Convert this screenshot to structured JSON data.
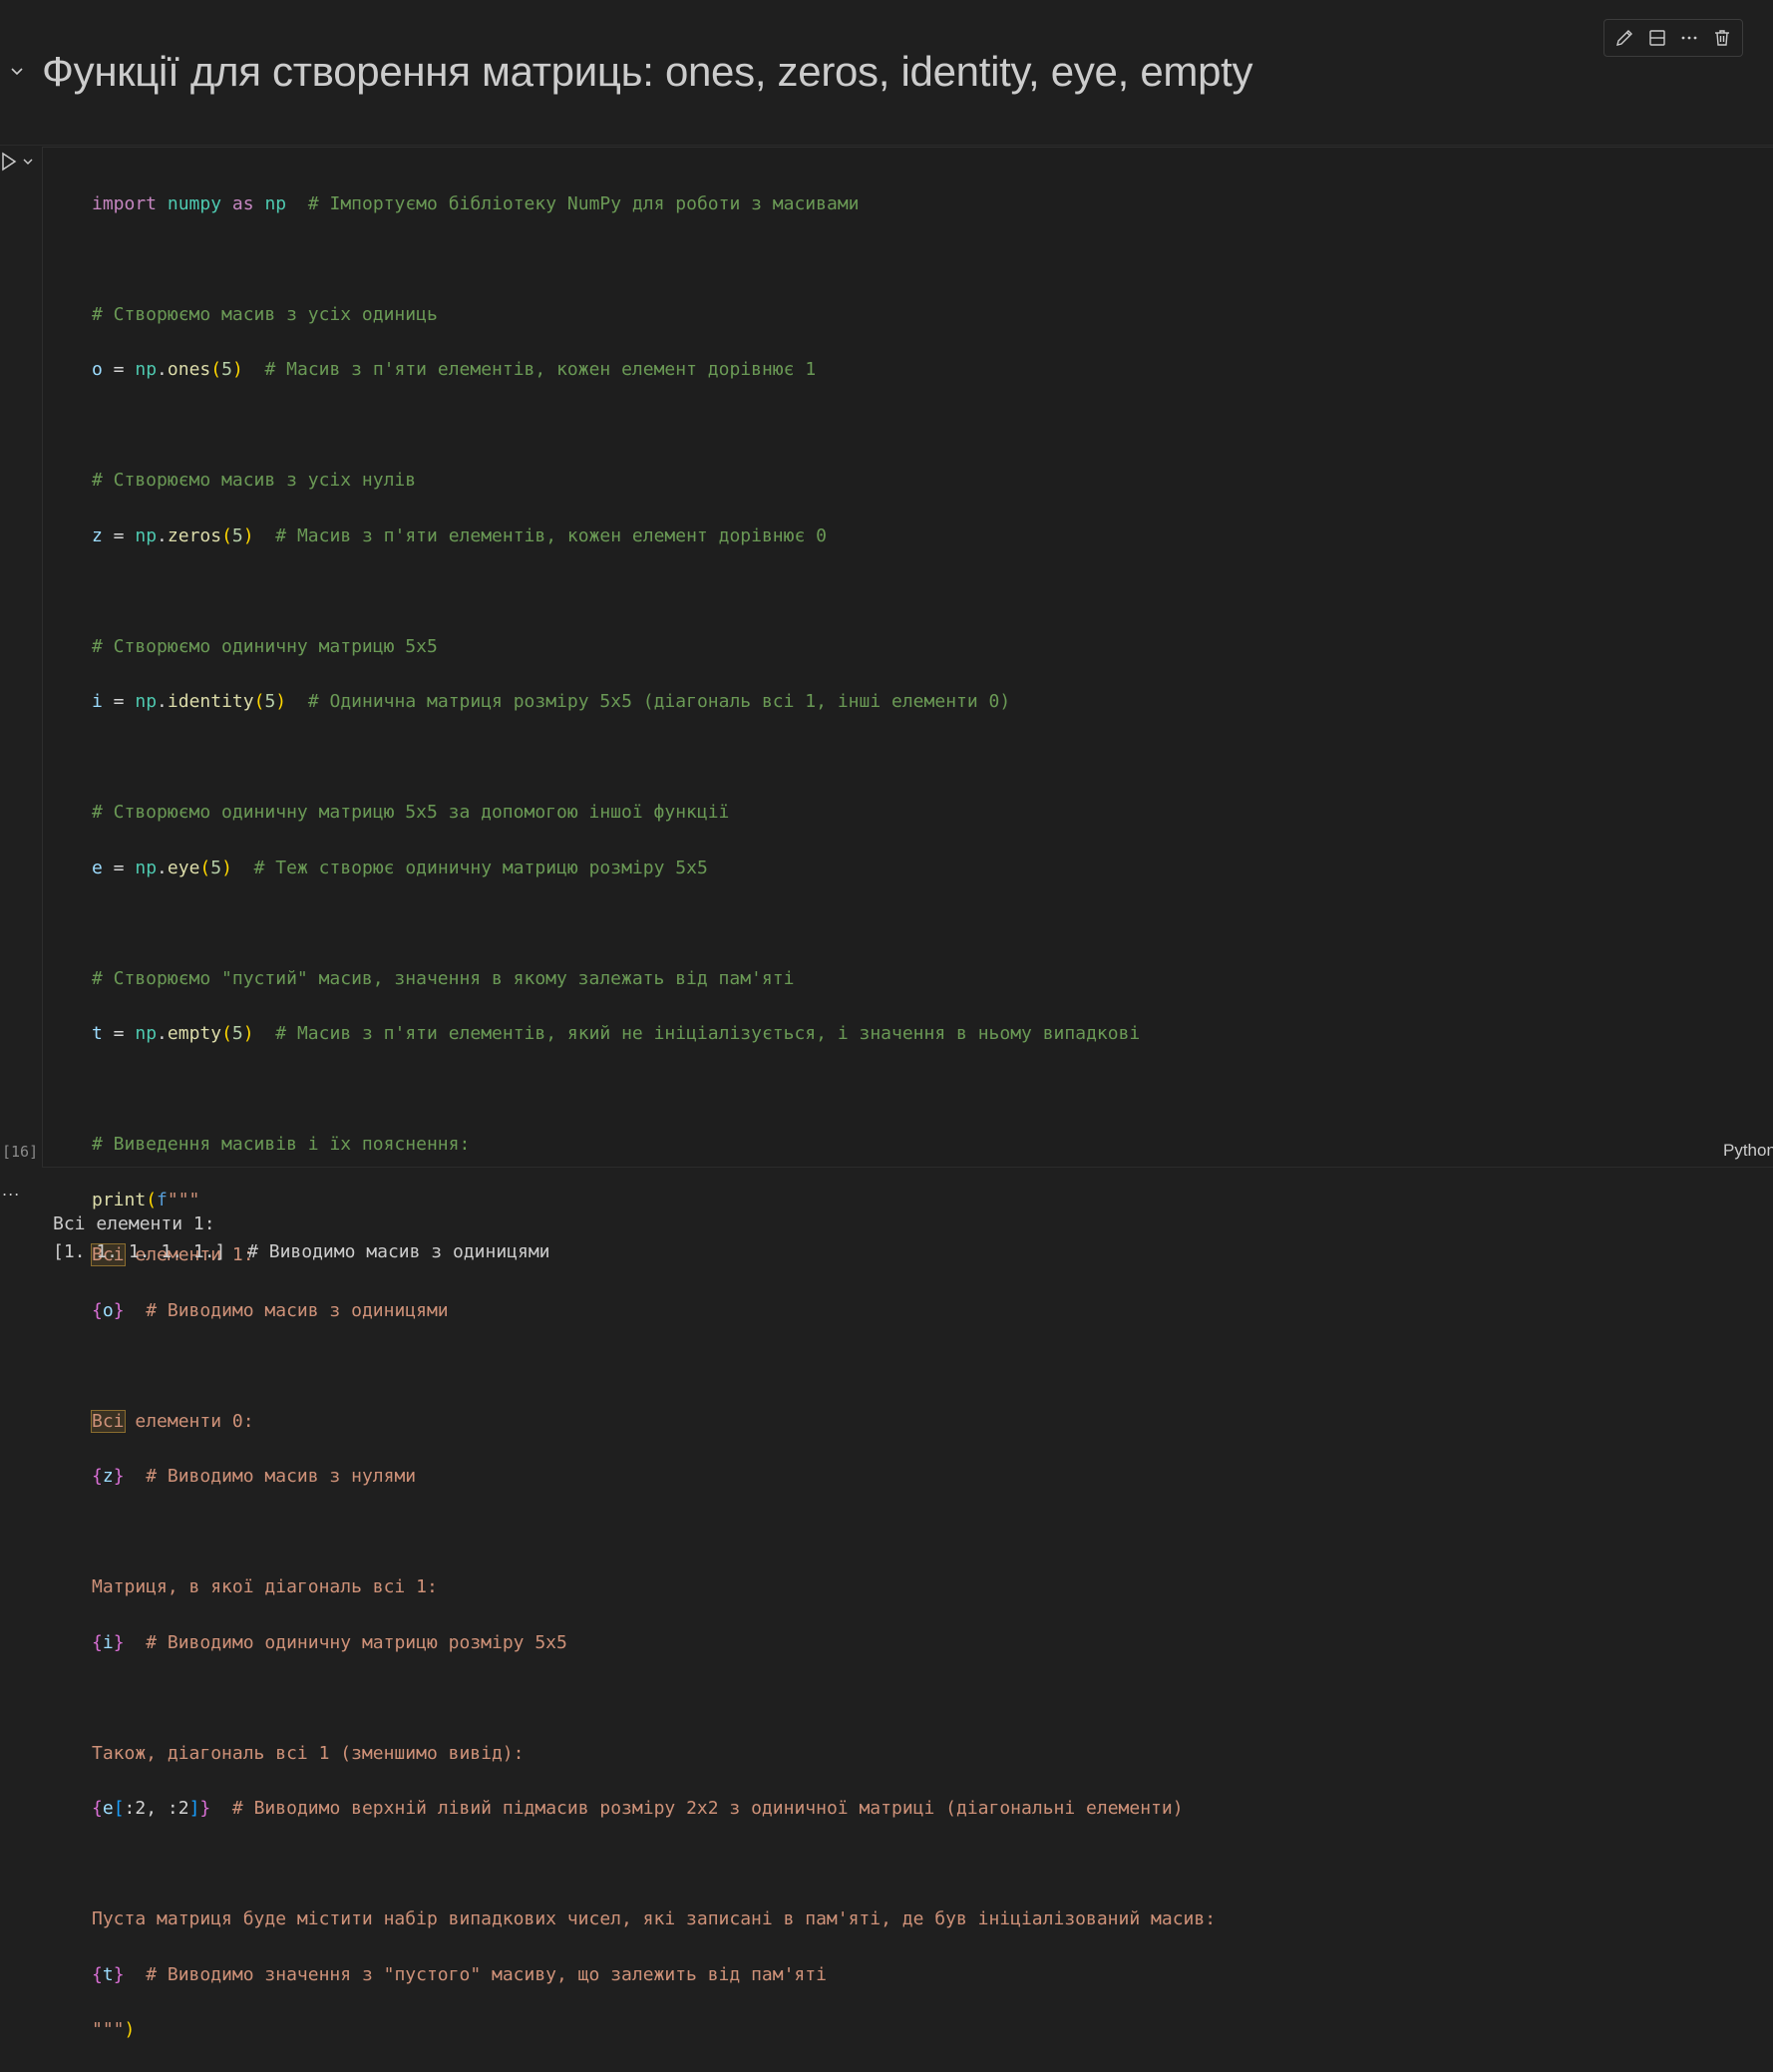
{
  "toolbar": {
    "icons": [
      "pencil-icon",
      "split-cell-icon",
      "more-icon",
      "trash-icon"
    ]
  },
  "markdown": {
    "heading": "Функції для створення матриць: ones, zeros, identity, eye, empty"
  },
  "cell": {
    "execution_count": "[16]",
    "language": "Python",
    "code": {
      "l1_kw": "import",
      "l1_mod": "numpy",
      "l1_as": "as",
      "l1_alias": "np",
      "l1_cm": "# Імпортуємо бібліотеку NumPy для роботи з масивами",
      "l3_cm": "# Створюємо масив з усіх одиниць",
      "l4_var": "o",
      "l4_eq": " = ",
      "l4_np": "np",
      "l4_fn": "ones",
      "l4_arg": "5",
      "l4_cm": "# Масив з п'яти елементів, кожен елемент дорівнює 1",
      "l6_cm": "# Створюємо масив з усіх нулів",
      "l7_var": "z",
      "l7_fn": "zeros",
      "l7_arg": "5",
      "l7_cm": "# Масив з п'яти елементів, кожен елемент дорівнює 0",
      "l9_cm": "# Створюємо одиничну матрицю 5x5",
      "l10_var": "i",
      "l10_fn": "identity",
      "l10_arg": "5",
      "l10_cm": "# Одинична матриця розміру 5x5 (діагональ всі 1, інші елементи 0)",
      "l12_cm": "# Створюємо одиничну матрицю 5x5 за допомогою іншої функції",
      "l13_var": "e",
      "l13_fn": "eye",
      "l13_arg": "5",
      "l13_cm": "# Теж створює одиничну матрицю розміру 5x5",
      "l15_cm": "# Створюємо \"пустий\" масив, значення в якому залежать від пам'яті",
      "l16_var": "t",
      "l16_fn": "empty",
      "l16_arg": "5",
      "l16_cm": "# Масив з п'яти елементів, який не ініціалізується, і значення в ньому випадкові",
      "l18_cm": "# Виведення масивів і їх пояснення:",
      "l19_fn": "print",
      "l19_f": "f",
      "l19_q": "\"\"\"",
      "l20_hl": "Всі",
      "l20_rest": " елементи 1:",
      "l21_var": "o",
      "l21_rest": "  # Виводимо масив з одиницями",
      "l23_hl": "Всі",
      "l23_rest": " елементи 0:",
      "l24_var": "z",
      "l24_rest": "  # Виводимо масив з нулями",
      "l26": "Матриця, в якої діагональ всі 1:",
      "l27_var": "i",
      "l27_rest": "  # Виводимо одиничну матрицю розміру 5x5",
      "l29": "Також, діагональ всі 1 (зменшимо вивід):",
      "l30_var": "e",
      "l30_slice": ":2, :2",
      "l30_rest": "  # Виводимо верхній лівий підмасив розміру 2x2 з одиничної матриці (діагональні елементи)",
      "l32": "Пуста матриця буде містити набір випадкових чисел, які записані в пам'яті, де був ініціалізований масив:",
      "l33_var": "t",
      "l33_rest": "  # Виводимо значення з \"пустого\" масиву, що залежить від пам'яті",
      "l34_q": "\"\"\""
    }
  },
  "output": {
    "ellipsis": "...",
    "line1": "Всі елементи 1:",
    "line2": "[1. 1. 1. 1. 1.]  # Виводимо масив з одиницями"
  }
}
